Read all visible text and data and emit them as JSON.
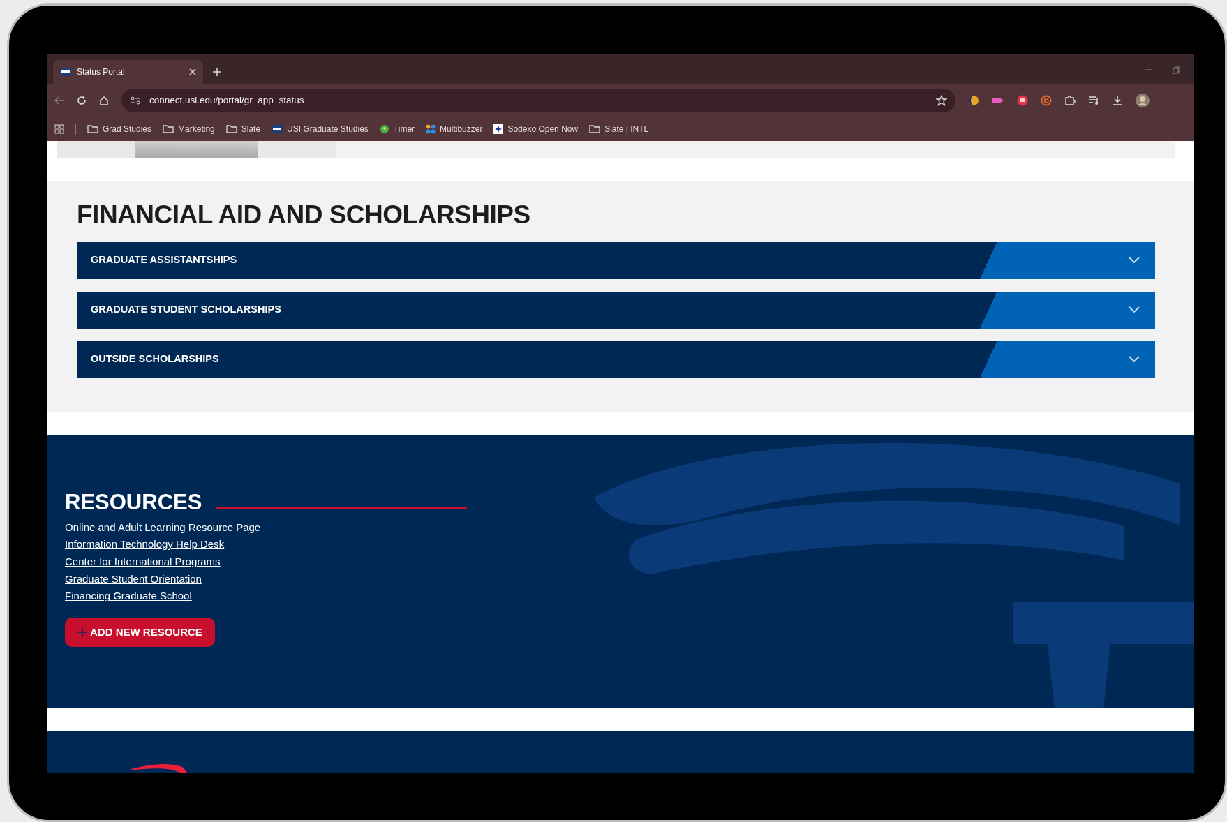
{
  "browser": {
    "tab": {
      "title": "Status Portal"
    },
    "address": "connect.usi.edu/portal/gr_app_status",
    "bookmarks": [
      {
        "label": "Grad Studies",
        "kind": "folder"
      },
      {
        "label": "Marketing",
        "kind": "folder"
      },
      {
        "label": "Slate",
        "kind": "folder"
      },
      {
        "label": "USI Graduate Studies",
        "kind": "usi"
      },
      {
        "label": "Timer",
        "kind": "timer"
      },
      {
        "label": "Multibuzzer",
        "kind": "dots"
      },
      {
        "label": "Sodexo Open Now",
        "kind": "star"
      },
      {
        "label": "Slate | INTL",
        "kind": "folder"
      }
    ]
  },
  "financial_aid": {
    "title": "FINANCIAL AID AND SCHOLARSHIPS",
    "items": [
      {
        "label": "GRADUATE ASSISTANTSHIPS",
        "expanded": false
      },
      {
        "label": "GRADUATE STUDENT SCHOLARSHIPS",
        "expanded": false
      },
      {
        "label": "OUTSIDE SCHOLARSHIPS",
        "expanded": false
      }
    ]
  },
  "resources": {
    "title": "RESOURCES",
    "links": [
      "Online and Adult Learning Resource Page",
      "Information Technology Help Desk",
      "Center for International Programs",
      "Graduate Student Orientation",
      "Financing Graduate School"
    ],
    "button": "ADD NEW RESOURCE"
  }
}
